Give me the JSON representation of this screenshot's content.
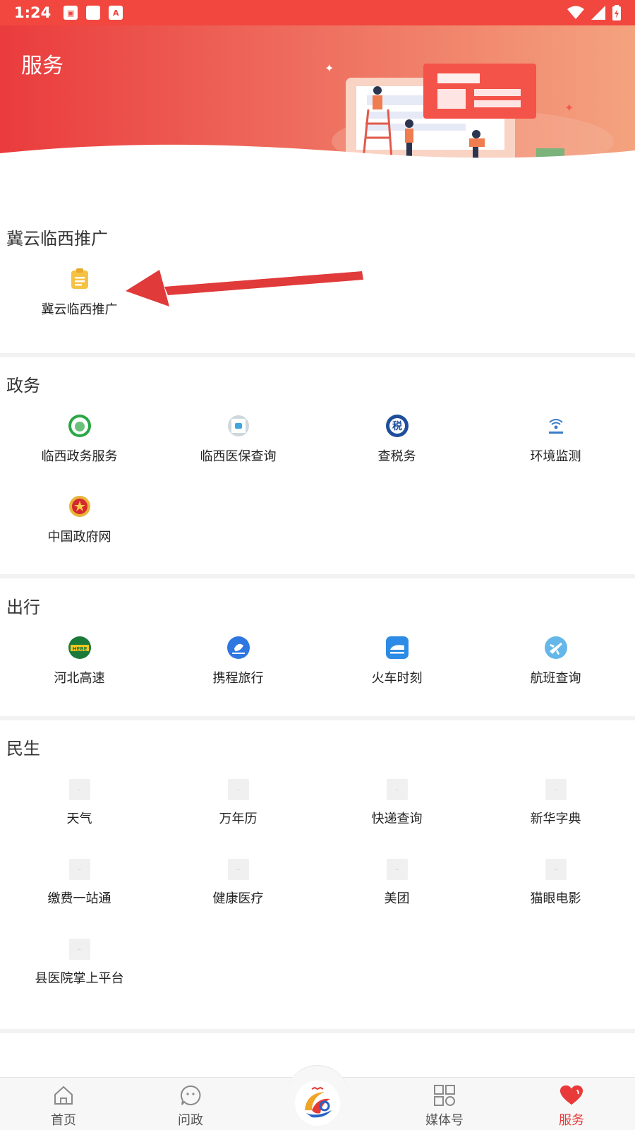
{
  "status_bar": {
    "time": "1:24"
  },
  "header": {
    "title": "服务"
  },
  "sections": [
    {
      "title": "冀云临西推广",
      "items": [
        {
          "label": "冀云临西推广",
          "icon": "clipboard-icon"
        }
      ]
    },
    {
      "title": "政务",
      "items": [
        {
          "label": "临西政务服务",
          "icon": "gov-service-icon"
        },
        {
          "label": "临西医保查询",
          "icon": "medical-insurance-icon"
        },
        {
          "label": "查税务",
          "icon": "tax-icon"
        },
        {
          "label": "环境监测",
          "icon": "environment-icon"
        },
        {
          "label": "中国政府网",
          "icon": "national-emblem-icon"
        }
      ]
    },
    {
      "title": "出行",
      "items": [
        {
          "label": "河北高速",
          "icon": "highway-icon"
        },
        {
          "label": "携程旅行",
          "icon": "ctrip-icon"
        },
        {
          "label": "火车时刻",
          "icon": "train-icon"
        },
        {
          "label": "航班查询",
          "icon": "plane-icon"
        }
      ]
    },
    {
      "title": "民生",
      "items": [
        {
          "label": "天气",
          "icon": "placeholder-icon"
        },
        {
          "label": "万年历",
          "icon": "placeholder-icon"
        },
        {
          "label": "快递查询",
          "icon": "placeholder-icon"
        },
        {
          "label": "新华字典",
          "icon": "placeholder-icon"
        },
        {
          "label": "缴费一站通",
          "icon": "placeholder-icon"
        },
        {
          "label": "健康医疗",
          "icon": "placeholder-icon"
        },
        {
          "label": "美团",
          "icon": "placeholder-icon"
        },
        {
          "label": "猫眼电影",
          "icon": "placeholder-icon"
        },
        {
          "label": "县医院掌上平台",
          "icon": "placeholder-icon"
        }
      ]
    }
  ],
  "tabbar": {
    "tabs": [
      {
        "label": "首页",
        "icon": "home-icon",
        "active": false
      },
      {
        "label": "问政",
        "icon": "chat-icon",
        "active": false
      },
      {
        "label": "",
        "icon": "app-logo-icon",
        "active": false
      },
      {
        "label": "媒体号",
        "icon": "grid-icon",
        "active": false
      },
      {
        "label": "服务",
        "icon": "heart-icon",
        "active": true
      }
    ]
  },
  "colors": {
    "accent": "#e93a3a",
    "header_start": "#ea3b3d",
    "header_end": "#f4a37f"
  }
}
